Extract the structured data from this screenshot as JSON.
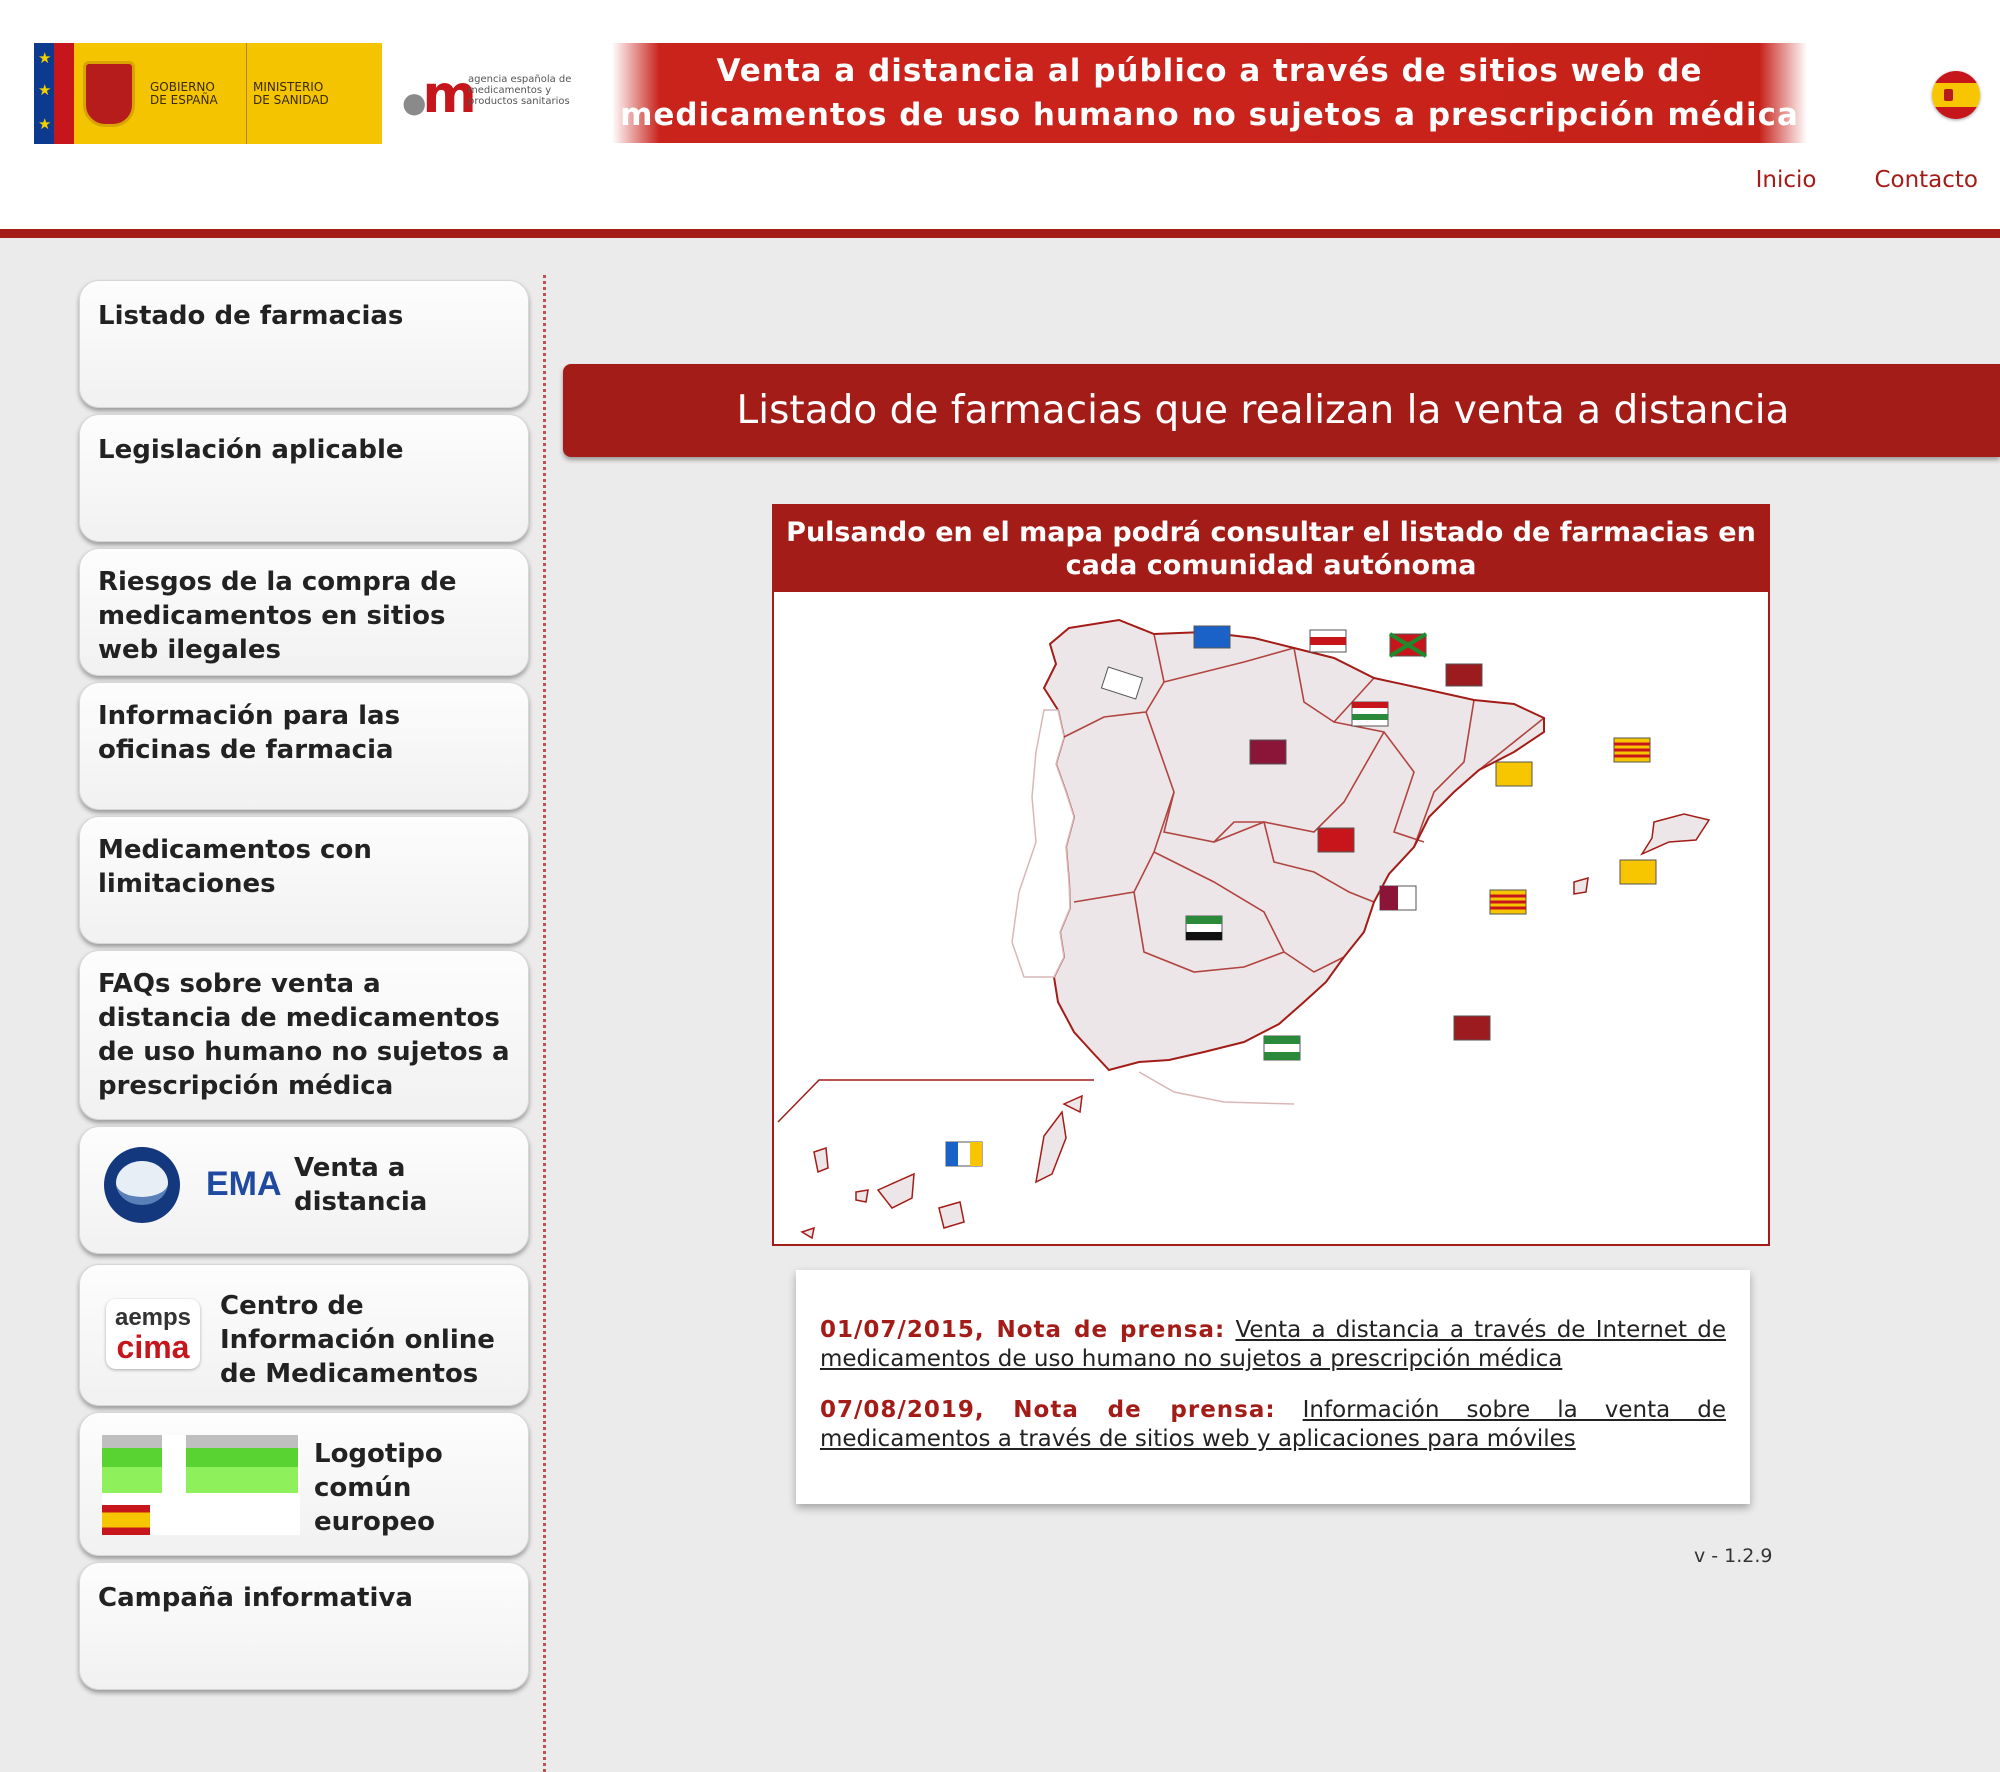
{
  "header": {
    "gov_logo": {
      "line1": "GOBIERNO\nDE ESPAÑA",
      "line2": "MINISTERIO\nDE SANIDAD"
    },
    "aemps_logo": {
      "text": "agencia española de medicamentos y productos sanitarios"
    },
    "banner": {
      "line1": "Venta a distancia al público a través de sitios web de",
      "line2": "medicamentos de uso humano no sujetos a prescripción médica"
    },
    "language_flag": "spain-flag-icon",
    "nav": [
      {
        "label": "Inicio"
      },
      {
        "label": "Contacto"
      }
    ],
    "accent_color": "#a31c17"
  },
  "sidebar": {
    "items": [
      {
        "label": "Listado de farmacias"
      },
      {
        "label": "Legislación aplicable"
      },
      {
        "label": "Riesgos de la compra de medicamentos en sitios web ilegales"
      },
      {
        "label": "Información para las oficinas de farmacia"
      },
      {
        "label": "Medicamentos con limitaciones"
      },
      {
        "label": "FAQs sobre venta a distancia de medicamentos de uso humano no sujetos a prescripción médica"
      },
      {
        "label": "Venta a distancia",
        "icon_text": "EMA",
        "icon": "ema-logo-icon"
      },
      {
        "label": "Centro de Información online de Medicamentos",
        "icon_text_top": "aemps",
        "icon_text_bottom": "cima",
        "icon": "cima-logo-icon"
      },
      {
        "label": "Logotipo común europeo",
        "icon": "eu-common-logo-icon"
      },
      {
        "label": "Campaña informativa"
      }
    ]
  },
  "main": {
    "title": "Listado de farmacias que realizan la venta a distancia",
    "map": {
      "caption": "Pulsando en el mapa podrá consultar el listado de farmacias en cada comunidad autónoma",
      "icon": "spain-regions-map"
    },
    "news": [
      {
        "date": "01/07/2015, Nota de prensa:",
        "link": "Venta a distancia a través de Internet de medicamentos de uso humano no sujetos a prescripción médica"
      },
      {
        "date": "07/08/2019, Nota de prensa:",
        "link": "Información sobre la venta de medicamentos a través de sitios web y aplicaciones para móviles"
      }
    ],
    "version": "v - 1.2.9"
  }
}
